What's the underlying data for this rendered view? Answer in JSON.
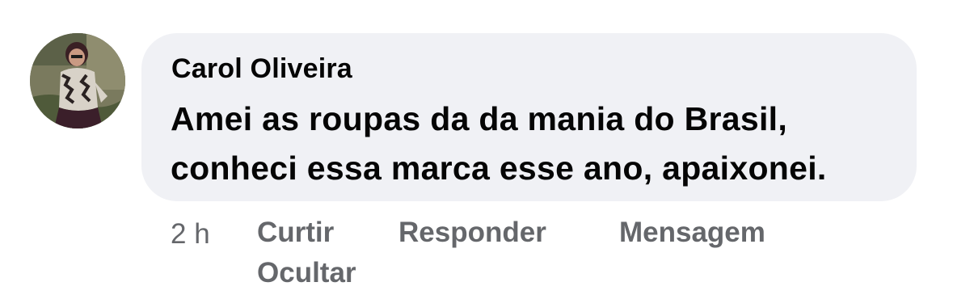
{
  "comment": {
    "author": "Carol Oliveira",
    "text_lines": [
      "Amei as roupas da da mania do Brasil,",
      "conheci essa marca esse ano, apaixonei."
    ]
  },
  "actions": {
    "time": "2 h",
    "like": "Curtir",
    "reply": "Responder",
    "message": "Mensagem",
    "hide": "Ocultar"
  },
  "colors": {
    "bubble": "#f0f1f5",
    "text": "#050505",
    "secondary": "#65676b"
  }
}
